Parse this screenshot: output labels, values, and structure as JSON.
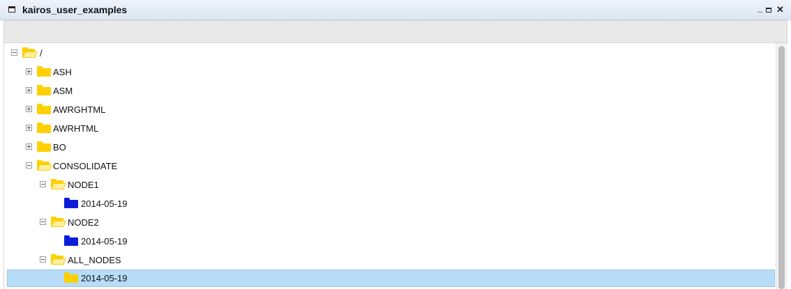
{
  "window": {
    "title": "kairos_user_examples"
  },
  "controls": {
    "minimize": "_",
    "close": "✕"
  },
  "tree": {
    "root": "/",
    "items": [
      {
        "label": "ASH"
      },
      {
        "label": "ASM"
      },
      {
        "label": "AWRGHTML"
      },
      {
        "label": "AWRHTML"
      },
      {
        "label": "BO"
      },
      {
        "label": "CONSOLIDATE"
      },
      {
        "label": "NODE1"
      },
      {
        "label": "2014-05-19"
      },
      {
        "label": "NODE2"
      },
      {
        "label": "2014-05-19"
      },
      {
        "label": "ALL_NODES"
      },
      {
        "label": "2014-05-19"
      }
    ]
  },
  "colors": {
    "folder": "#ffd000",
    "folder_leaf": "#0a1ed8",
    "selection": "#b7dcf8"
  }
}
